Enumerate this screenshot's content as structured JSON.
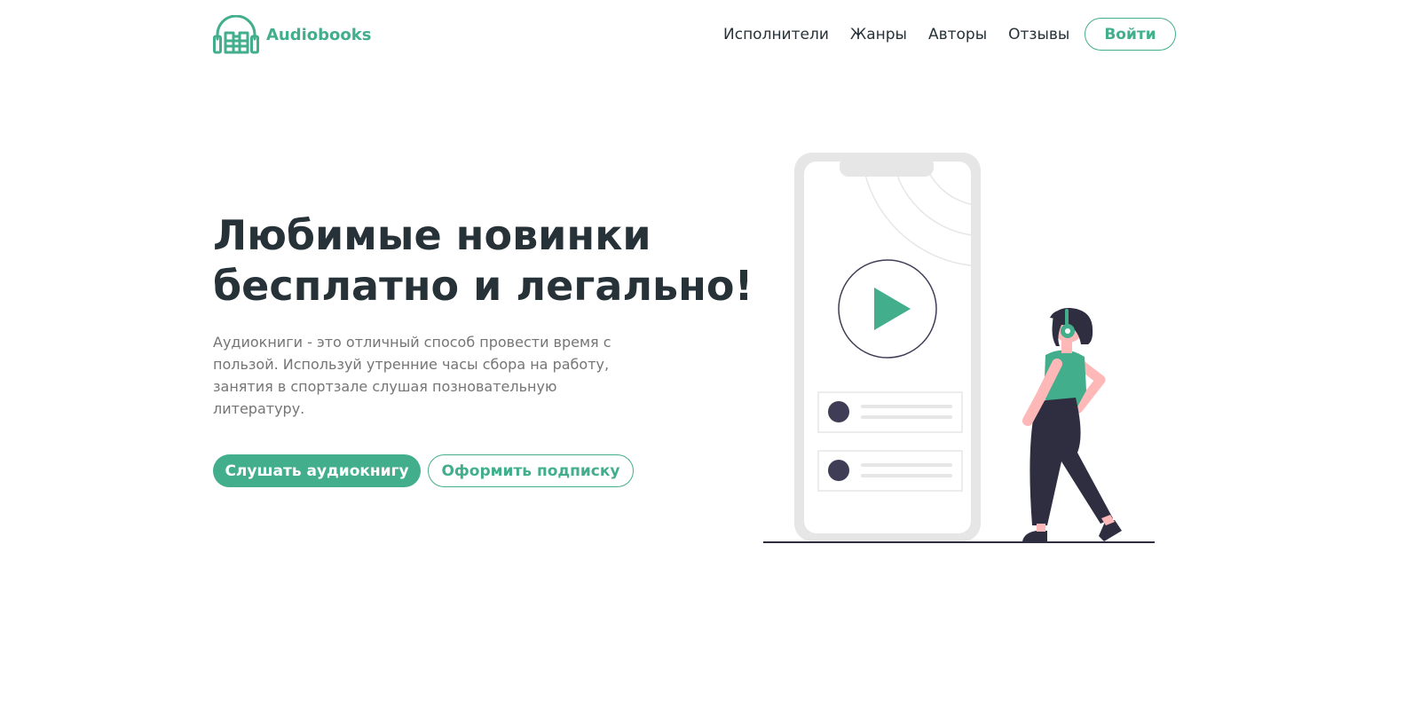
{
  "header": {
    "logo_text": "Audiobooks",
    "logo_icon": "headphones-books-icon",
    "nav": [
      {
        "label": "Исполнители"
      },
      {
        "label": "Жанры"
      },
      {
        "label": "Авторы"
      },
      {
        "label": "Отзывы"
      }
    ],
    "login_label": "Войти"
  },
  "hero": {
    "title_line1": "Любимые новинки",
    "title_line2": "бесплатно и легально!",
    "description": "Аудиокниги - это  отличный способ провести время с пользой. Используй утренние часы сбора на работу, занятия в спортзале слушая позновательную литературу.",
    "primary_button": "Слушать аудиокнигу",
    "secondary_button": "Оформить подписку"
  },
  "illustration": {
    "phone_icon": "phone-player-icon",
    "play_icon": "play-icon",
    "person_icon": "person-headphones-icon"
  },
  "colors": {
    "accent": "#42ae8c",
    "heading": "#263238",
    "body_text": "#757575",
    "phone_frame": "#e6e6e6",
    "dark": "#2f2e41"
  }
}
